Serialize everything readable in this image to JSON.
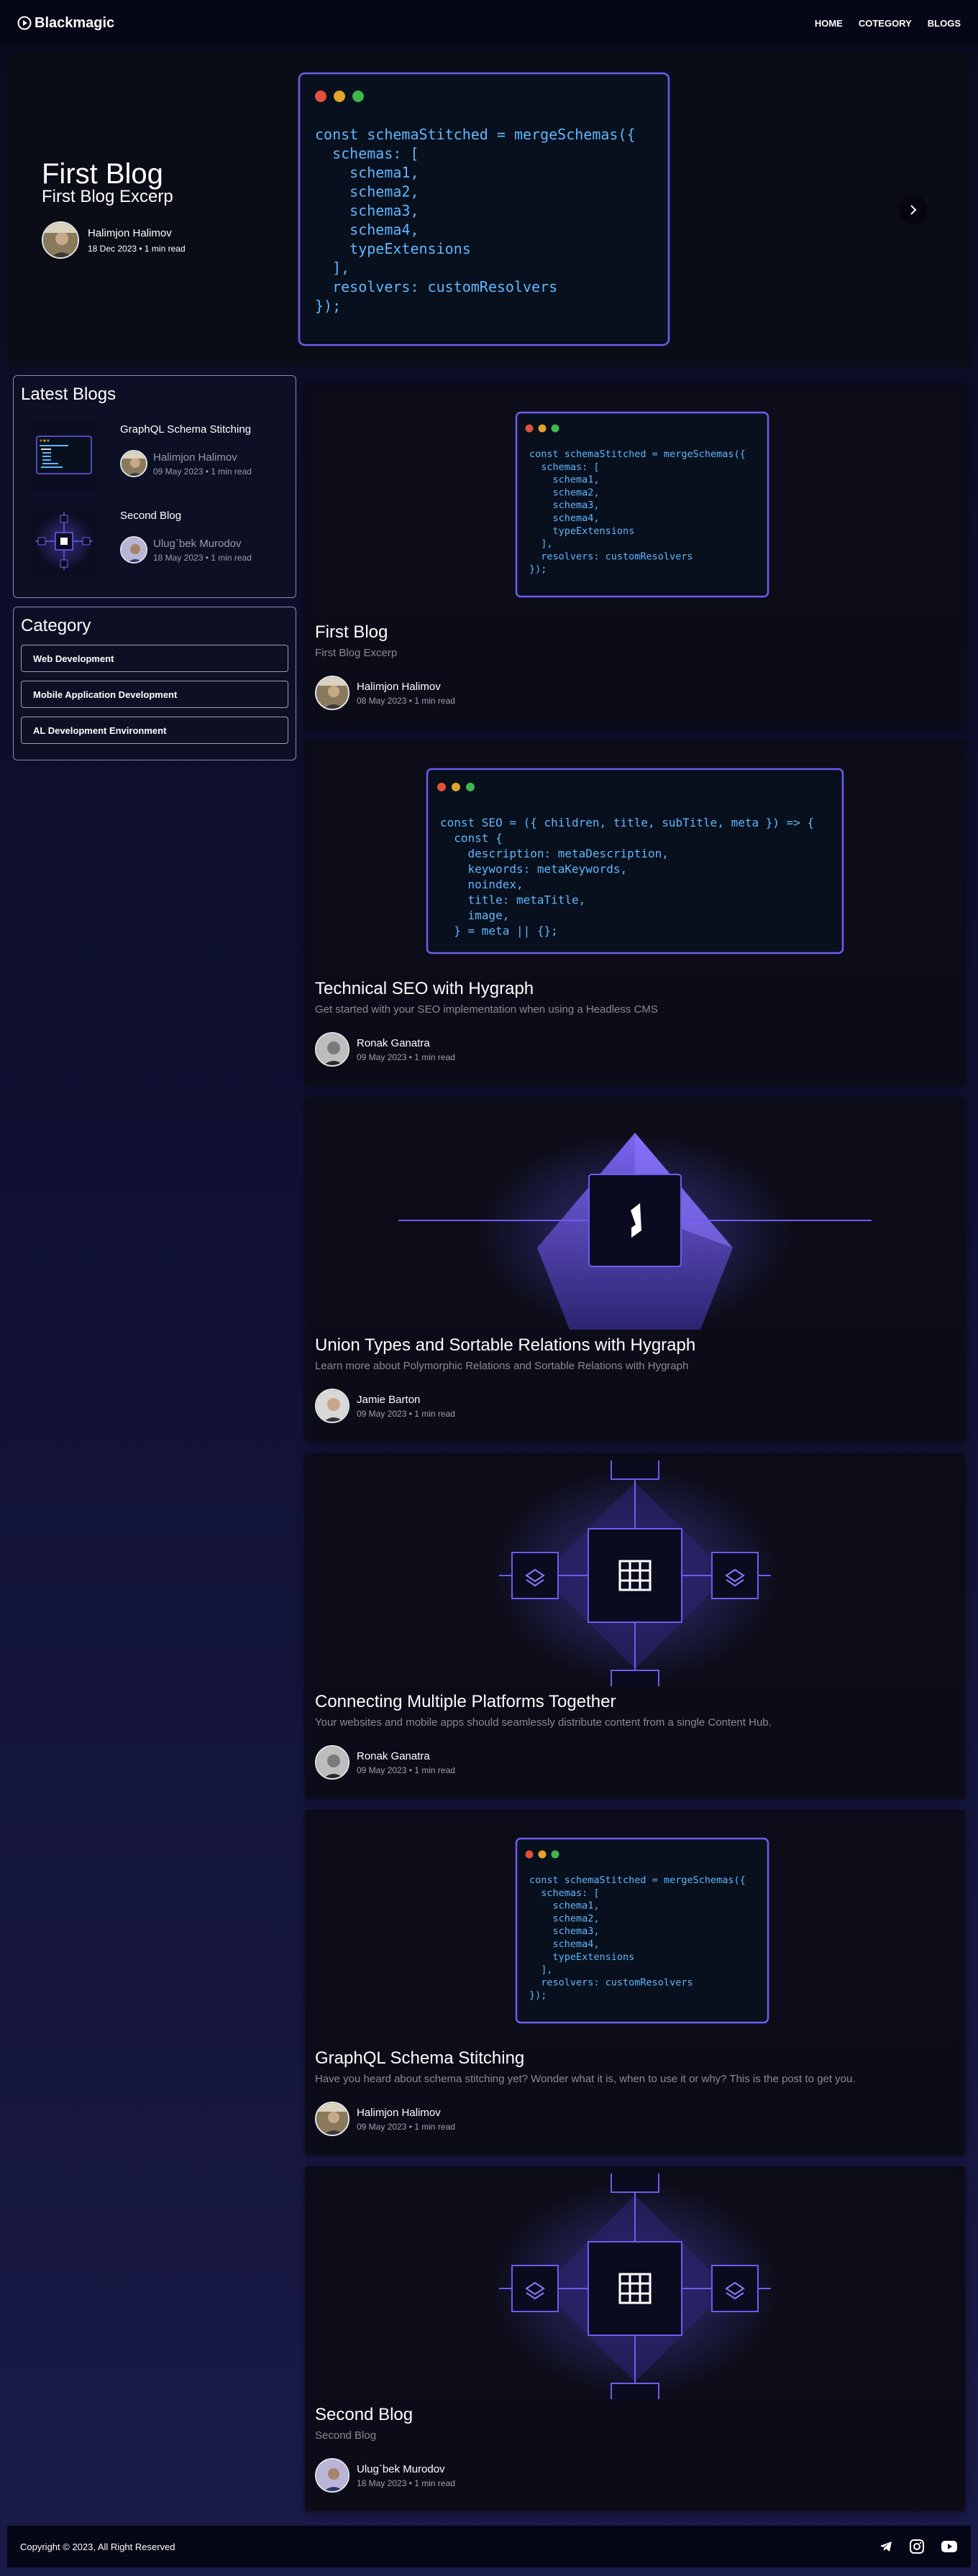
{
  "brand": {
    "name": "Blackmagic"
  },
  "nav": [
    {
      "label": "HOME"
    },
    {
      "label": "COTEGORY"
    },
    {
      "label": "BLOGS"
    }
  ],
  "hero": {
    "title": "First Blog",
    "subtitle": "First Blog Excerp",
    "author": "Halimjon Halimov",
    "meta": "18 Dec 2023 • 1 min read",
    "next_icon": "chevron-right-icon"
  },
  "code_stitch": [
    "const schemaStitched = mergeSchemas({",
    "  schemas: [",
    "    schema1,",
    "    schema2,",
    "    schema3,",
    "    schema4,",
    "    typeExtensions",
    "  ],",
    "  resolvers: customResolvers",
    "});"
  ],
  "code_seo": [
    "const SEO = ({ children, title, subTitle, meta }) => {",
    "  const {",
    "    description: metaDescription,",
    "    keywords: metaKeywords,",
    "    noindex,",
    "    title: metaTitle,",
    "    image,",
    "  } = meta || {};"
  ],
  "sidebar": {
    "latest_title": "Latest Blogs",
    "latest": [
      {
        "title": "GraphQL Schema Stitching",
        "author": "Halimjon Halimov",
        "meta": "09 May 2023 • 1 min read"
      },
      {
        "title": "Second Blog",
        "author": "Ulug`bek Murodov",
        "meta": "18 May 2023 • 1 min read"
      }
    ],
    "category_title": "Category",
    "categories": [
      {
        "label": "Web Development"
      },
      {
        "label": "Mobile Application Development"
      },
      {
        "label": "AL Development Environment"
      }
    ]
  },
  "posts": [
    {
      "title": "First Blog",
      "excerpt": "First Blog Excerp",
      "author": "Halimjon Halimov",
      "meta": "08 May 2023 • 1 min read"
    },
    {
      "title": "Technical SEO with Hygraph",
      "excerpt": "Get started with your SEO implementation when using a Headless CMS",
      "author": "Ronak Ganatra",
      "meta": "09 May 2023 • 1 min read"
    },
    {
      "title": "Union Types and Sortable Relations with Hygraph",
      "excerpt": "Learn more about Polymorphic Relations and Sortable Relations with Hygraph",
      "author": "Jamie Barton",
      "meta": "09 May 2023 • 1 min read"
    },
    {
      "title": "Connecting Multiple Platforms Together",
      "excerpt": "Your websites and mobile apps should seamlessly distribute content from a single Content Hub.",
      "author": "Ronak Ganatra",
      "meta": "09 May 2023 • 1 min read"
    },
    {
      "title": "GraphQL Schema Stitching",
      "excerpt": "Have you heard about schema stitching yet? Wonder what it is, when to use it or why? This is the post to get you.",
      "author": "Halimjon Halimov",
      "meta": "09 May 2023 • 1 min read"
    },
    {
      "title": "Second Blog",
      "excerpt": "Second Blog",
      "author": "Ulug`bek Murodov",
      "meta": "18 May 2023 • 1 min read"
    }
  ],
  "footer": {
    "copyright": "Copyright © 2023, All Right Reserved",
    "social_icons": [
      "telegram-icon",
      "instagram-icon",
      "youtube-icon"
    ]
  },
  "colors": {
    "page_bg": "#0f1030",
    "header_bg": "#050616",
    "accent": "#6e5cf0",
    "code_keyword": "#b48cff",
    "code_value": "#62b6ff"
  }
}
